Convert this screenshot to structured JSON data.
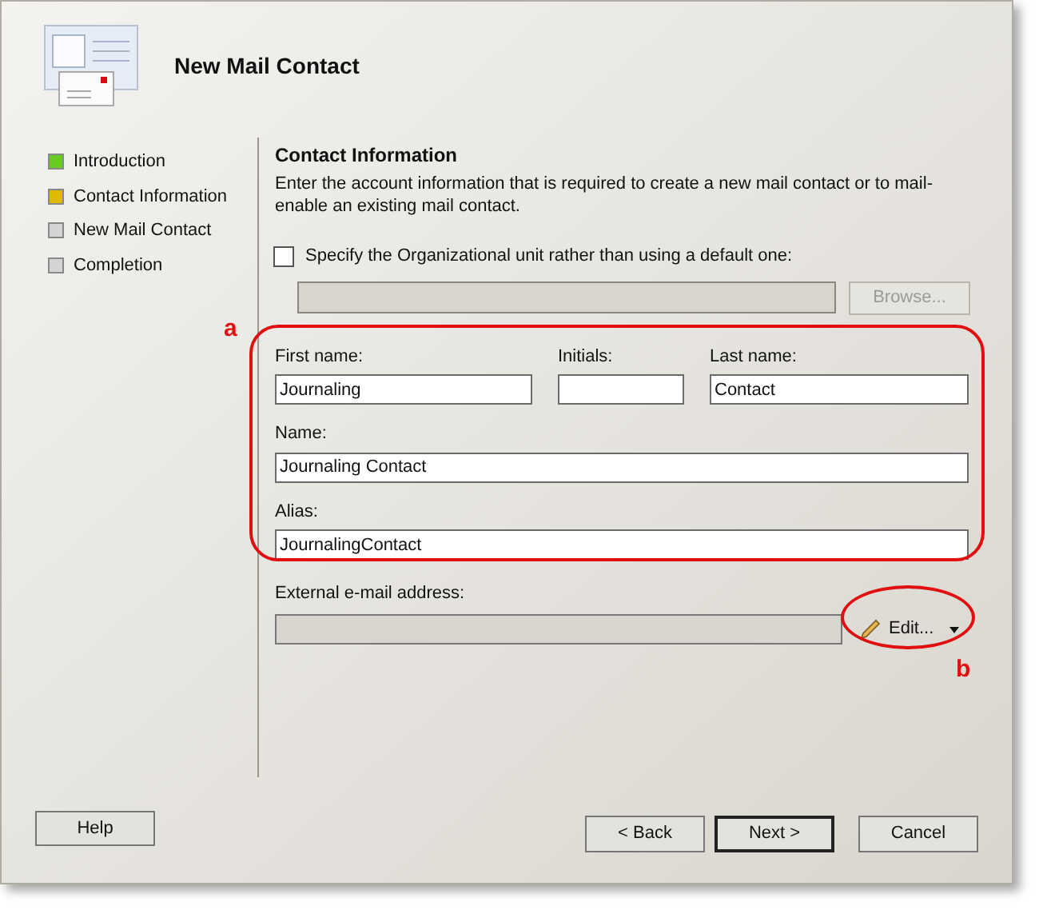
{
  "window": {
    "title": "New Mail Contact"
  },
  "steps": [
    {
      "label": "Introduction",
      "color": "#66cc22"
    },
    {
      "label": "Contact Information",
      "color": "#e0b800"
    },
    {
      "label": "New Mail Contact",
      "color": "#d4d4d4"
    },
    {
      "label": "Completion",
      "color": "#d4d4d4"
    }
  ],
  "section": {
    "title": "Contact Information",
    "description": "Enter the account information that is required to create a new mail contact or to mail-enable an existing mail contact."
  },
  "ou": {
    "label": "Specify the Organizational unit rather than using a default one:",
    "checked": false,
    "browse": "Browse...",
    "disabled": true
  },
  "fields": {
    "first_name": {
      "label": "First name:",
      "value": "Journaling"
    },
    "initials": {
      "label": "Initials:"
    },
    "last_name": {
      "label": "Last name:",
      "value": "Contact"
    },
    "name": {
      "label": "Name:",
      "value": "Journaling Contact"
    },
    "alias": {
      "label": "Alias:",
      "value": "JournalingContact"
    }
  },
  "external": {
    "label": "External e-mail address:",
    "edit": "Edit..."
  },
  "annotations": [
    {
      "label": "a"
    },
    {
      "label": "b"
    }
  ],
  "buttons": {
    "help": "Help",
    "back": "< Back",
    "next": "Next >",
    "cancel": "Cancel"
  }
}
